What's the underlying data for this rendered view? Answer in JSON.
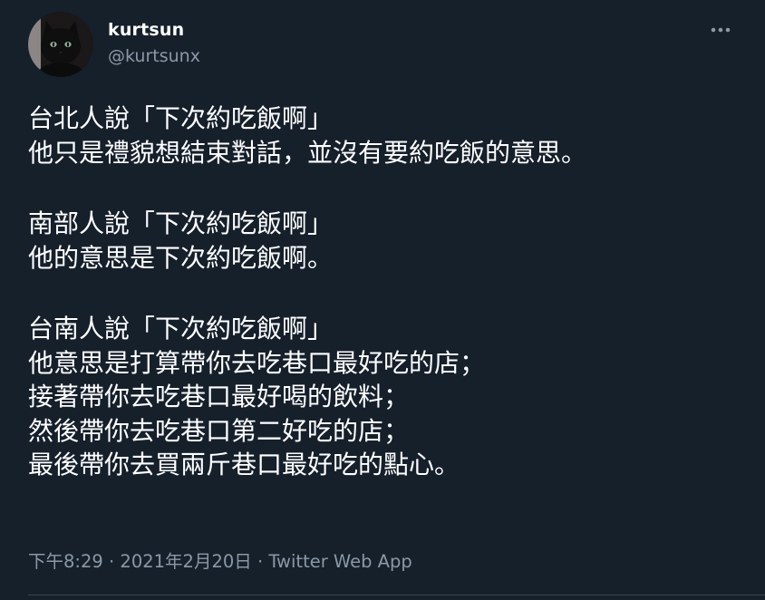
{
  "user": {
    "display_name": "kurtsun",
    "handle": "@kurtsunx"
  },
  "tweet": {
    "paragraph1": {
      "line1": "台北人說「下次約吃飯啊」",
      "line2": "他只是禮貌想結束對話，並沒有要約吃飯的意思。"
    },
    "paragraph2": {
      "line1": "南部人說「下次約吃飯啊」",
      "line2": "他的意思是下次約吃飯啊。"
    },
    "paragraph3": {
      "line1": "台南人說「下次約吃飯啊」",
      "line2": "他意思是打算帶你去吃巷口最好吃的店；",
      "line3": "接著帶你去吃巷口最好喝的飲料；",
      "line4": "然後帶你去吃巷口第二好吃的店；",
      "line5": "最後帶你去買兩斤巷口最好吃的點心。"
    }
  },
  "meta": {
    "time": "下午8:29",
    "separator1": " · ",
    "date": "2021年2月20日",
    "separator2": " · ",
    "source": "Twitter Web App"
  },
  "icons": {
    "more": "more-horizontal-icon",
    "avatar": "black-cat-avatar"
  },
  "colors": {
    "background": "#15202b",
    "primary_text": "#ffffff",
    "secondary_text": "#8b98a5",
    "divider": "#38444d"
  }
}
